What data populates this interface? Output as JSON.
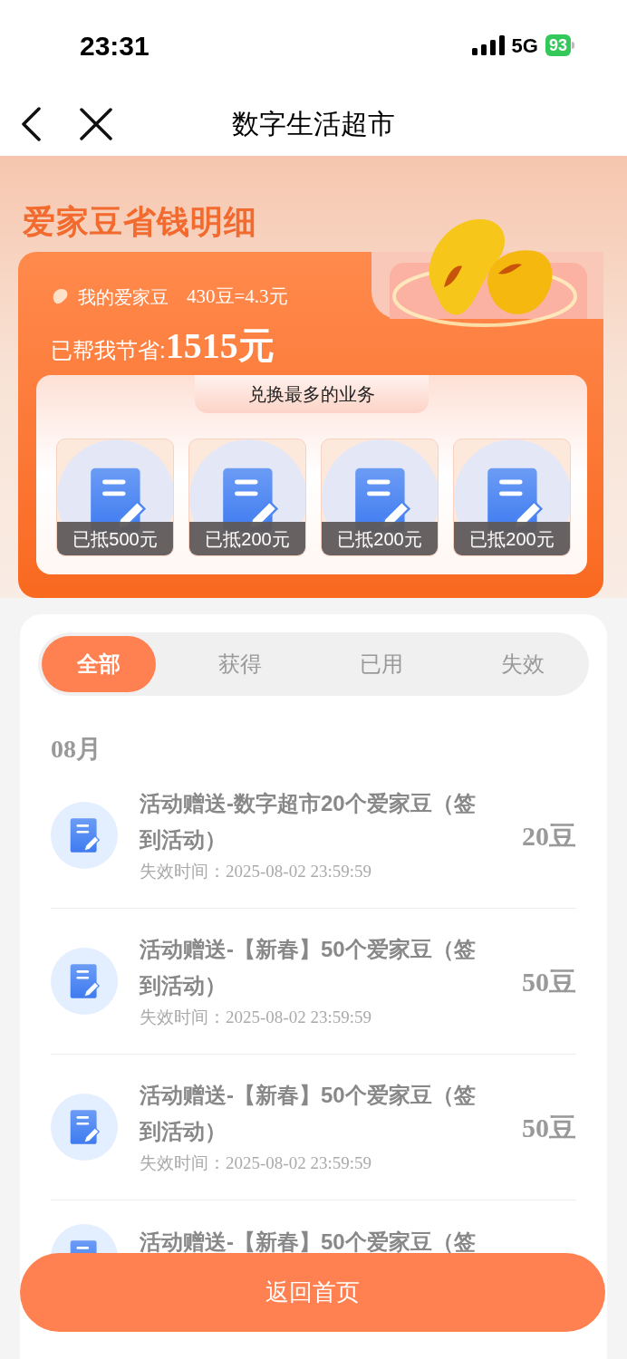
{
  "status_bar": {
    "time": "23:31",
    "network": "5G",
    "battery": "93"
  },
  "nav": {
    "title": "数字生活超市"
  },
  "banner": {
    "heading": "爱家豆省钱明细",
    "beans_label": "我的爱家豆",
    "beans_value": "430豆=4.3元",
    "saved_label": "已帮我节省:",
    "saved_amount": "1515元",
    "top_services": {
      "title": "兑换最多的业务",
      "items": [
        {
          "label": "已抵500元"
        },
        {
          "label": "已抵200元"
        },
        {
          "label": "已抵200元"
        },
        {
          "label": "已抵200元"
        }
      ]
    }
  },
  "tabs": [
    {
      "label": "全部",
      "selected": true
    },
    {
      "label": "获得",
      "selected": false
    },
    {
      "label": "已用",
      "selected": false
    },
    {
      "label": "失效",
      "selected": false
    }
  ],
  "month": "08月",
  "records": [
    {
      "title": "活动赠送-数字超市20个爱家豆（签到活动）",
      "expire_label": "失效时间：",
      "expire_time": "2025-08-02 23:59:59",
      "amount": "20豆"
    },
    {
      "title": "活动赠送-【新春】50个爱家豆（签到活动）",
      "expire_label": "失效时间：",
      "expire_time": "2025-08-02 23:59:59",
      "amount": "50豆"
    },
    {
      "title": "活动赠送-【新春】50个爱家豆（签到活动）",
      "expire_label": "失效时间：",
      "expire_time": "2025-08-02 23:59:59",
      "amount": "50豆"
    },
    {
      "title": "活动赠送-【新春】50个爱家豆（签"
    }
  ],
  "home_button": "返回首页"
}
